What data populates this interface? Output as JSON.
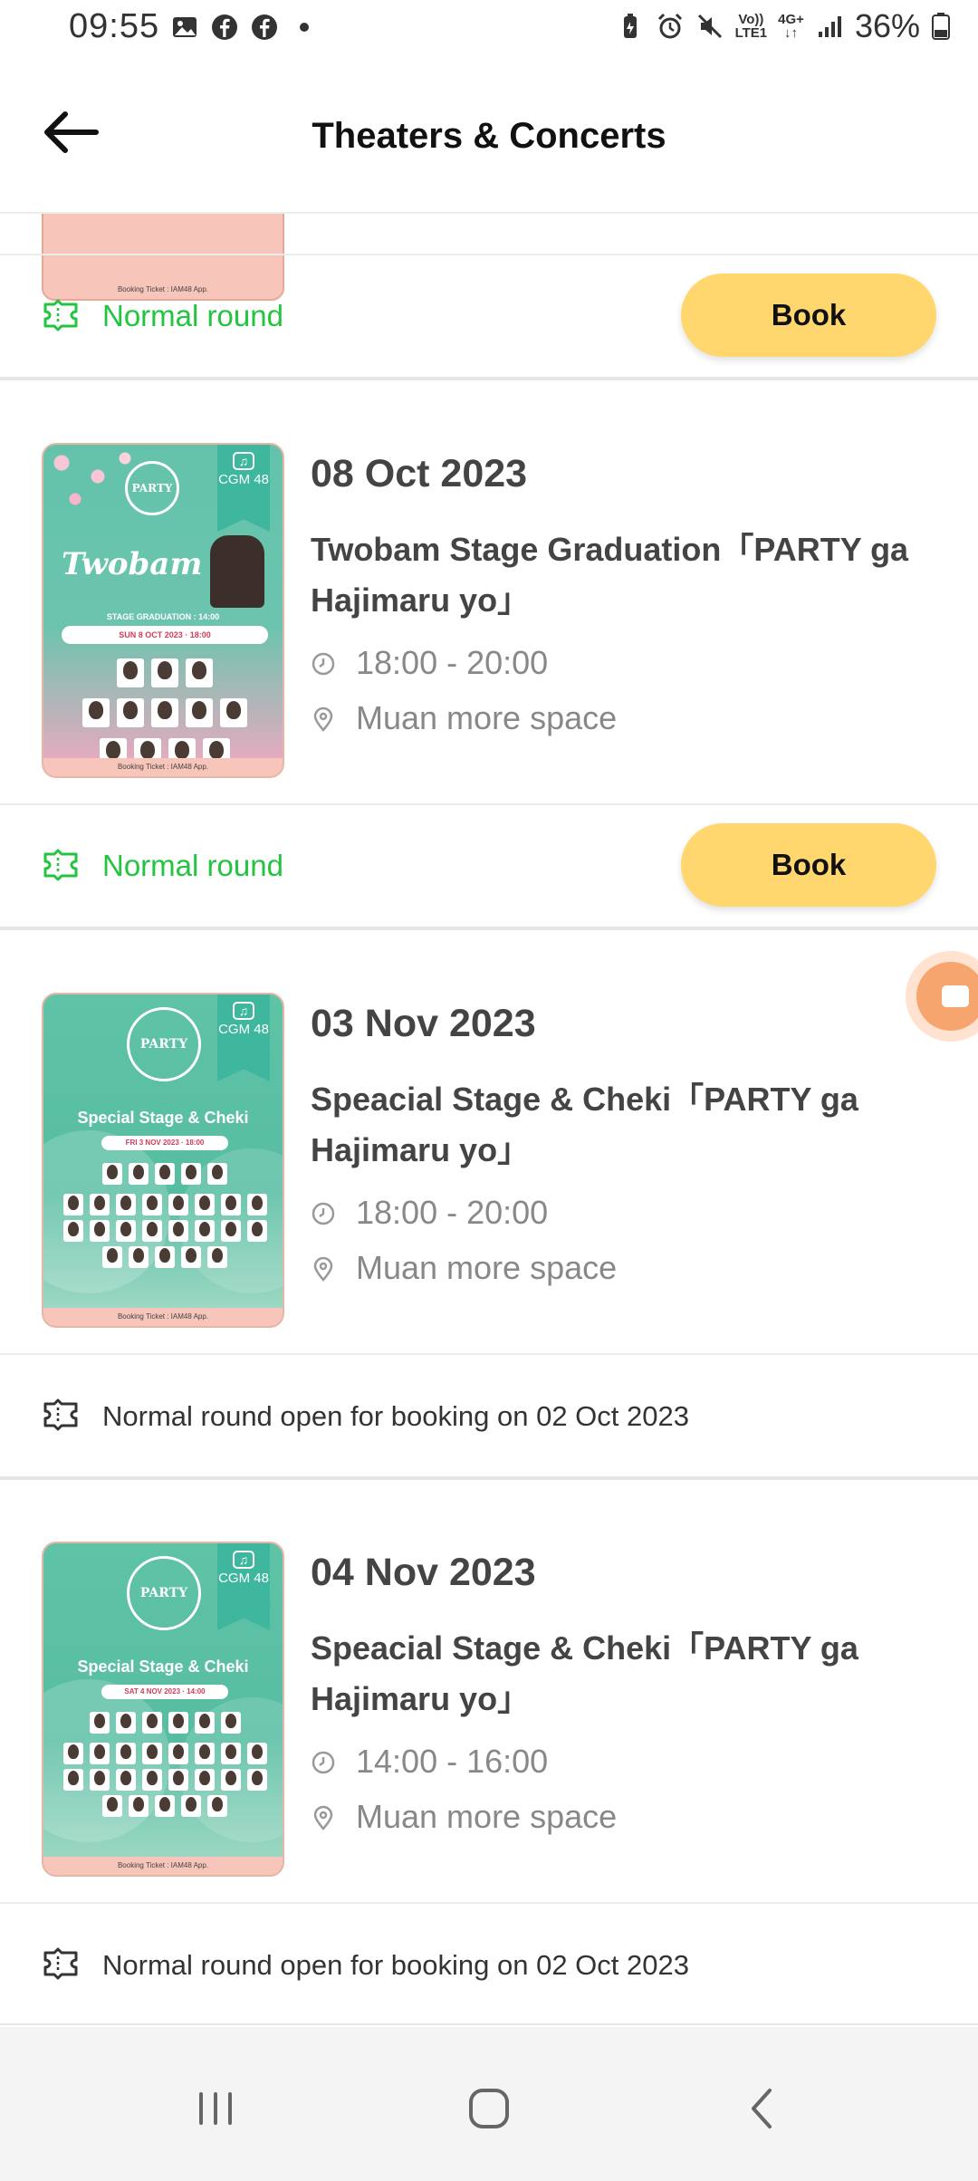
{
  "status_bar": {
    "time": "09:55",
    "left_icons": [
      "gallery-icon",
      "facebook-icon",
      "facebook-icon",
      "dot-icon"
    ],
    "network_volte": "Vo))",
    "network_lte": "LTE1",
    "network_type": "4G+",
    "battery": "36%"
  },
  "app_bar": {
    "title": "Theaters & Concerts"
  },
  "top_round": {
    "label": "Normal round",
    "button": "Book"
  },
  "events": [
    {
      "date": "08 Oct 2023",
      "name": "Twobam Stage Graduation「PARTY ga Hajimaru yo」",
      "time": "18:00 - 20:00",
      "venue": "Muan more space",
      "poster_title": "Twobam",
      "poster_subtitle": "STAGE GRADUATION : 14:00",
      "poster_date": "SUN 8 OCT 2023 · 18:00",
      "poster_badge": "CGM 48",
      "round_label": "Normal round",
      "round_button": "Book"
    },
    {
      "date": "03 Nov 2023",
      "name": "Speacial Stage & Cheki「PARTY ga Hajimaru yo」",
      "time": "18:00 - 20:00",
      "venue": "Muan more space",
      "poster_title": "Special Stage & Cheki",
      "poster_date": "FRI 3 NOV 2023 · 18:00",
      "poster_badge": "CGM 48",
      "round_label": "Normal round open for booking on 02 Oct 2023"
    },
    {
      "date": "04 Nov 2023",
      "name": "Speacial Stage & Cheki「PARTY ga Hajimaru yo」",
      "time": "14:00 - 16:00",
      "venue": "Muan more space",
      "poster_title": "Special Stage & Cheki",
      "poster_date": "SAT 4 NOV 2023 · 14:00",
      "poster_badge": "CGM 48",
      "round_label": "Normal round open for booking on 02 Oct 2023"
    }
  ],
  "poster_logo": "PARTY",
  "poster_footer": "Booking Ticket : IAM48 App.",
  "colors": {
    "accent_yellow": "#ffd76e",
    "green": "#22c440",
    "poster_teal": "#63c3aa",
    "text_dark": "#444444",
    "text_muted": "#888888"
  },
  "nav_bar": {
    "icons": [
      "recent-apps-icon",
      "home-icon",
      "back-nav-icon"
    ]
  }
}
